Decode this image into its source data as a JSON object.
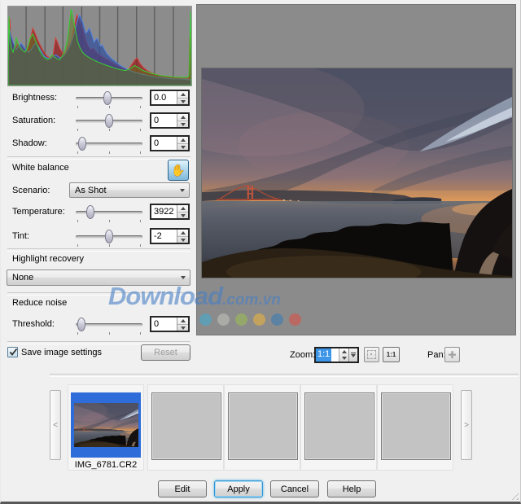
{
  "adjustments": {
    "brightness": {
      "label": "Brightness:",
      "value": "0.0"
    },
    "saturation": {
      "label": "Saturation:",
      "value": "0"
    },
    "shadow": {
      "label": "Shadow:",
      "value": "0"
    }
  },
  "white_balance": {
    "section_title": "White balance",
    "scenario_label": "Scenario:",
    "scenario_value": "As Shot",
    "temperature_label": "Temperature:",
    "temperature_value": "3922",
    "tint_label": "Tint:",
    "tint_value": "-2"
  },
  "highlight_recovery": {
    "section_title": "Highlight recovery",
    "value": "None"
  },
  "reduce_noise": {
    "section_title": "Reduce noise",
    "threshold_label": "Threshold:",
    "threshold_value": "0"
  },
  "settings_row": {
    "save_settings_label": "Save image settings",
    "reset_label": "Reset"
  },
  "zoom_bar": {
    "zoom_label": "Zoom:",
    "zoom_value": "1:1",
    "actual_size_button": "1:1",
    "pan_label": "Pan:"
  },
  "filmstrip": {
    "prev": "<",
    "next": ">",
    "selected_filename": "IMG_6781.CR2"
  },
  "footer": {
    "edit": "Edit",
    "apply": "Apply",
    "cancel": "Cancel",
    "help": "Help"
  },
  "watermark": {
    "main": "Download",
    "suffix": ".com.vn",
    "dots": [
      "#55a2be",
      "#b2b2ae",
      "#97af63",
      "#d1a753",
      "#5080a9",
      "#c55f57"
    ]
  }
}
